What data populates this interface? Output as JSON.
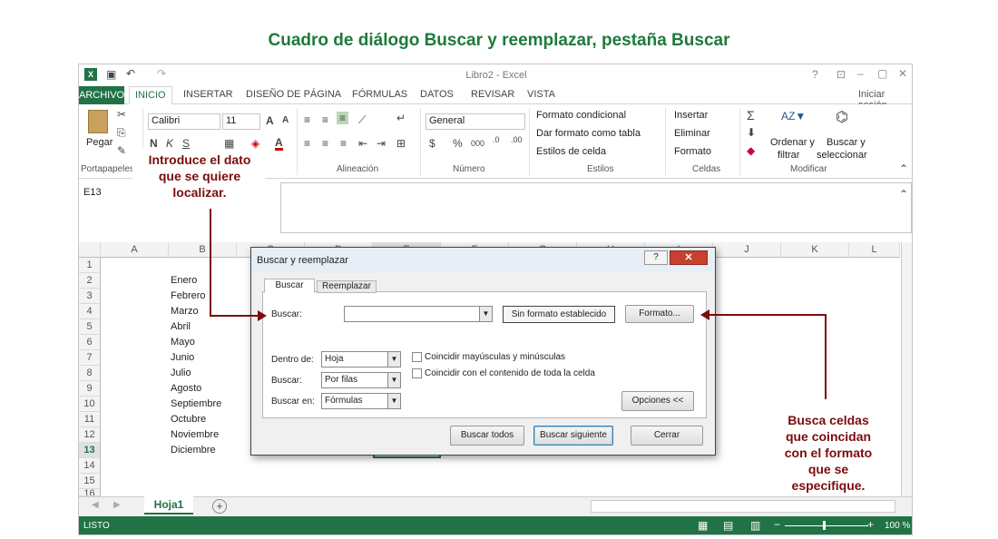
{
  "page_title": "Cuadro de diálogo Buscar y reemplazar, pestaña Buscar",
  "window": {
    "title": "Libro2 - Excel",
    "help": "?",
    "min": "–",
    "restore": "▢",
    "close": "✕",
    "signin": "Iniciar sesión"
  },
  "tabs": [
    "ARCHIVO",
    "INICIO",
    "INSERTAR",
    "DISEÑO DE PÁGINA",
    "FÓRMULAS",
    "DATOS",
    "REVISAR",
    "VISTA"
  ],
  "ribbon": {
    "paste": "Pegar",
    "font_name": "Calibri",
    "font_size": "11",
    "number_format": "General",
    "cond_format": "Formato condicional",
    "table_format": "Dar formato como tabla",
    "cell_styles": "Estilos de celda",
    "insert": "Insertar",
    "delete": "Eliminar",
    "format": "Formato",
    "sort1": "Ordenar y",
    "sort2": "filtrar",
    "find1": "Buscar y",
    "find2": "seleccionar",
    "groups": [
      "Portapapeles",
      "Fuente",
      "Alineación",
      "Número",
      "Estilos",
      "Celdas",
      "Modificar"
    ]
  },
  "namebox": "E13",
  "columns": [
    "A",
    "B",
    "C",
    "D",
    "E",
    "F",
    "G",
    "H",
    "I",
    "J",
    "K",
    "L"
  ],
  "rows": [
    "1",
    "2",
    "3",
    "4",
    "5",
    "6",
    "7",
    "8",
    "9",
    "10",
    "11",
    "12",
    "13",
    "14",
    "15",
    "16"
  ],
  "months": [
    "Enero",
    "Febrero",
    "Marzo",
    "Abril",
    "Mayo",
    "Junio",
    "Julio",
    "Agosto",
    "Septiembre",
    "Octubre",
    "Noviembre",
    "Diciembre"
  ],
  "sheet": {
    "tab": "Hoja1",
    "add": "+"
  },
  "status": {
    "mode": "LISTO",
    "zoom": "100 %"
  },
  "dialog": {
    "title": "Buscar y reemplazar",
    "tab_find": "Buscar",
    "tab_replace": "Reemplazar",
    "find_label": "Buscar:",
    "find_value": "",
    "no_format": "Sin formato establecido",
    "format_btn": "Formato...",
    "within_label": "Dentro de:",
    "within_value": "Hoja",
    "search_label": "Buscar:",
    "search_value": "Por filas",
    "lookin_label": "Buscar en:",
    "lookin_value": "Fórmulas",
    "match_case": "Coincidir mayúsculas y minúsculas",
    "match_whole": "Coincidir con el contenido de toda la celda",
    "options": "Opciones <<",
    "find_all": "Buscar todos",
    "find_next": "Buscar siguiente",
    "close": "Cerrar"
  },
  "annotations": {
    "left": [
      "Introduce el dato",
      "que se quiere",
      "localizar."
    ],
    "right": [
      "Busca celdas",
      "que coincidan",
      "con el formato",
      "que se",
      "especifique."
    ]
  },
  "colors": {
    "excel_green": "#217346",
    "annotation": "#7a0c0c",
    "title_green": "#1e7a3c"
  }
}
